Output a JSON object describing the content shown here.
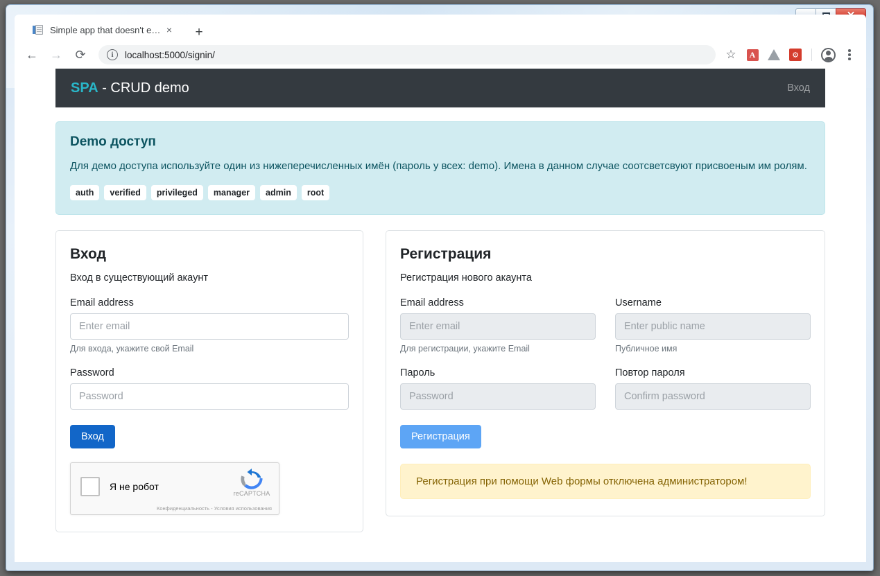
{
  "window": {
    "minimize_label": "–",
    "maximize_label": "",
    "close_label": "✕"
  },
  "browser": {
    "tab_title": "Simple app that doesn't exist",
    "tab_close_label": "×",
    "new_tab_label": "+",
    "back_label": "←",
    "forward_label": "→",
    "reload_label": "⟳",
    "info_label": "i",
    "url": "localhost:5000/signin/",
    "star_label": "☆",
    "pdf_label": "A",
    "ext_label": "⚙"
  },
  "navbar": {
    "brand_prefix": "SPA",
    "brand_suffix": " - CRUD demo",
    "signin_link": "Вход",
    "brand_accent": "#29b6c8",
    "background": "#343a40"
  },
  "info_alert": {
    "title": "Demo доступ",
    "text": "Для демо доступа используйте один из нижеперечисленных имён (пароль у всех: demo). Имена в данном случае соотсветсвуют присвоеным им ролям.",
    "background": "#d1ecf1",
    "color": "#0c5460",
    "roles": [
      "auth",
      "verified",
      "privileged",
      "manager",
      "admin",
      "root"
    ]
  },
  "login_card": {
    "title": "Вход",
    "subtitle": "Вход в существующий акаунт",
    "email_label": "Email address",
    "email_placeholder": "Enter email",
    "email_value": "",
    "email_help": "Для входа, укажите свой Email",
    "password_label": "Password",
    "password_placeholder": "Password",
    "password_value": "",
    "submit_label": "Вход",
    "submit_color": "#1266c8"
  },
  "recaptcha": {
    "checkbox_label": "Я не робот",
    "brand": "reCAPTCHA",
    "fine_print": "Конфиденциальность - Условия использования",
    "checked": false
  },
  "register_card": {
    "title": "Регистрация",
    "subtitle": "Регистрация нового акаунта",
    "email_label": "Email address",
    "email_placeholder": "Enter email",
    "email_value": "",
    "email_help": "Для регистрации, укажите Email",
    "username_label": "Username",
    "username_placeholder": "Enter public name",
    "username_value": "",
    "username_help": "Публичное имя",
    "password_label": "Пароль",
    "password_placeholder": "Password",
    "password_value": "",
    "confirm_label": "Повтор пароля",
    "confirm_placeholder": "Confirm password",
    "confirm_value": "",
    "submit_label": "Регистрация",
    "submit_color": "#5da5f5",
    "warning": "Регистрация при помощи Web формы отключена администратором!",
    "warning_background": "#fff3cd",
    "warning_color": "#856404"
  }
}
